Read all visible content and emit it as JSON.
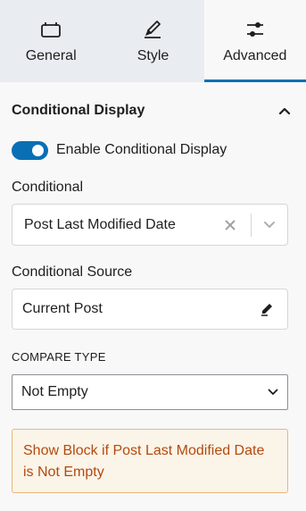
{
  "tabs": [
    {
      "label": "General",
      "icon": "block-icon",
      "active": false
    },
    {
      "label": "Style",
      "icon": "brush-icon",
      "active": false
    },
    {
      "label": "Advanced",
      "icon": "sliders-icon",
      "active": true
    }
  ],
  "section": {
    "title": "Conditional Display"
  },
  "toggle": {
    "label": "Enable Conditional Display",
    "checked": true
  },
  "conditional": {
    "label": "Conditional",
    "value": "Post Last Modified Date"
  },
  "source": {
    "label": "Conditional Source",
    "value": "Current Post"
  },
  "compare": {
    "label": "COMPARE TYPE",
    "value": "Not Empty"
  },
  "notice": {
    "text": "Show Block if Post Last Modified Date is Not Empty"
  },
  "colors": {
    "accent": "#0a6fb5",
    "notice_text": "#b24a0e",
    "notice_bg": "#fbf4e8",
    "notice_border": "#e8b77b"
  }
}
